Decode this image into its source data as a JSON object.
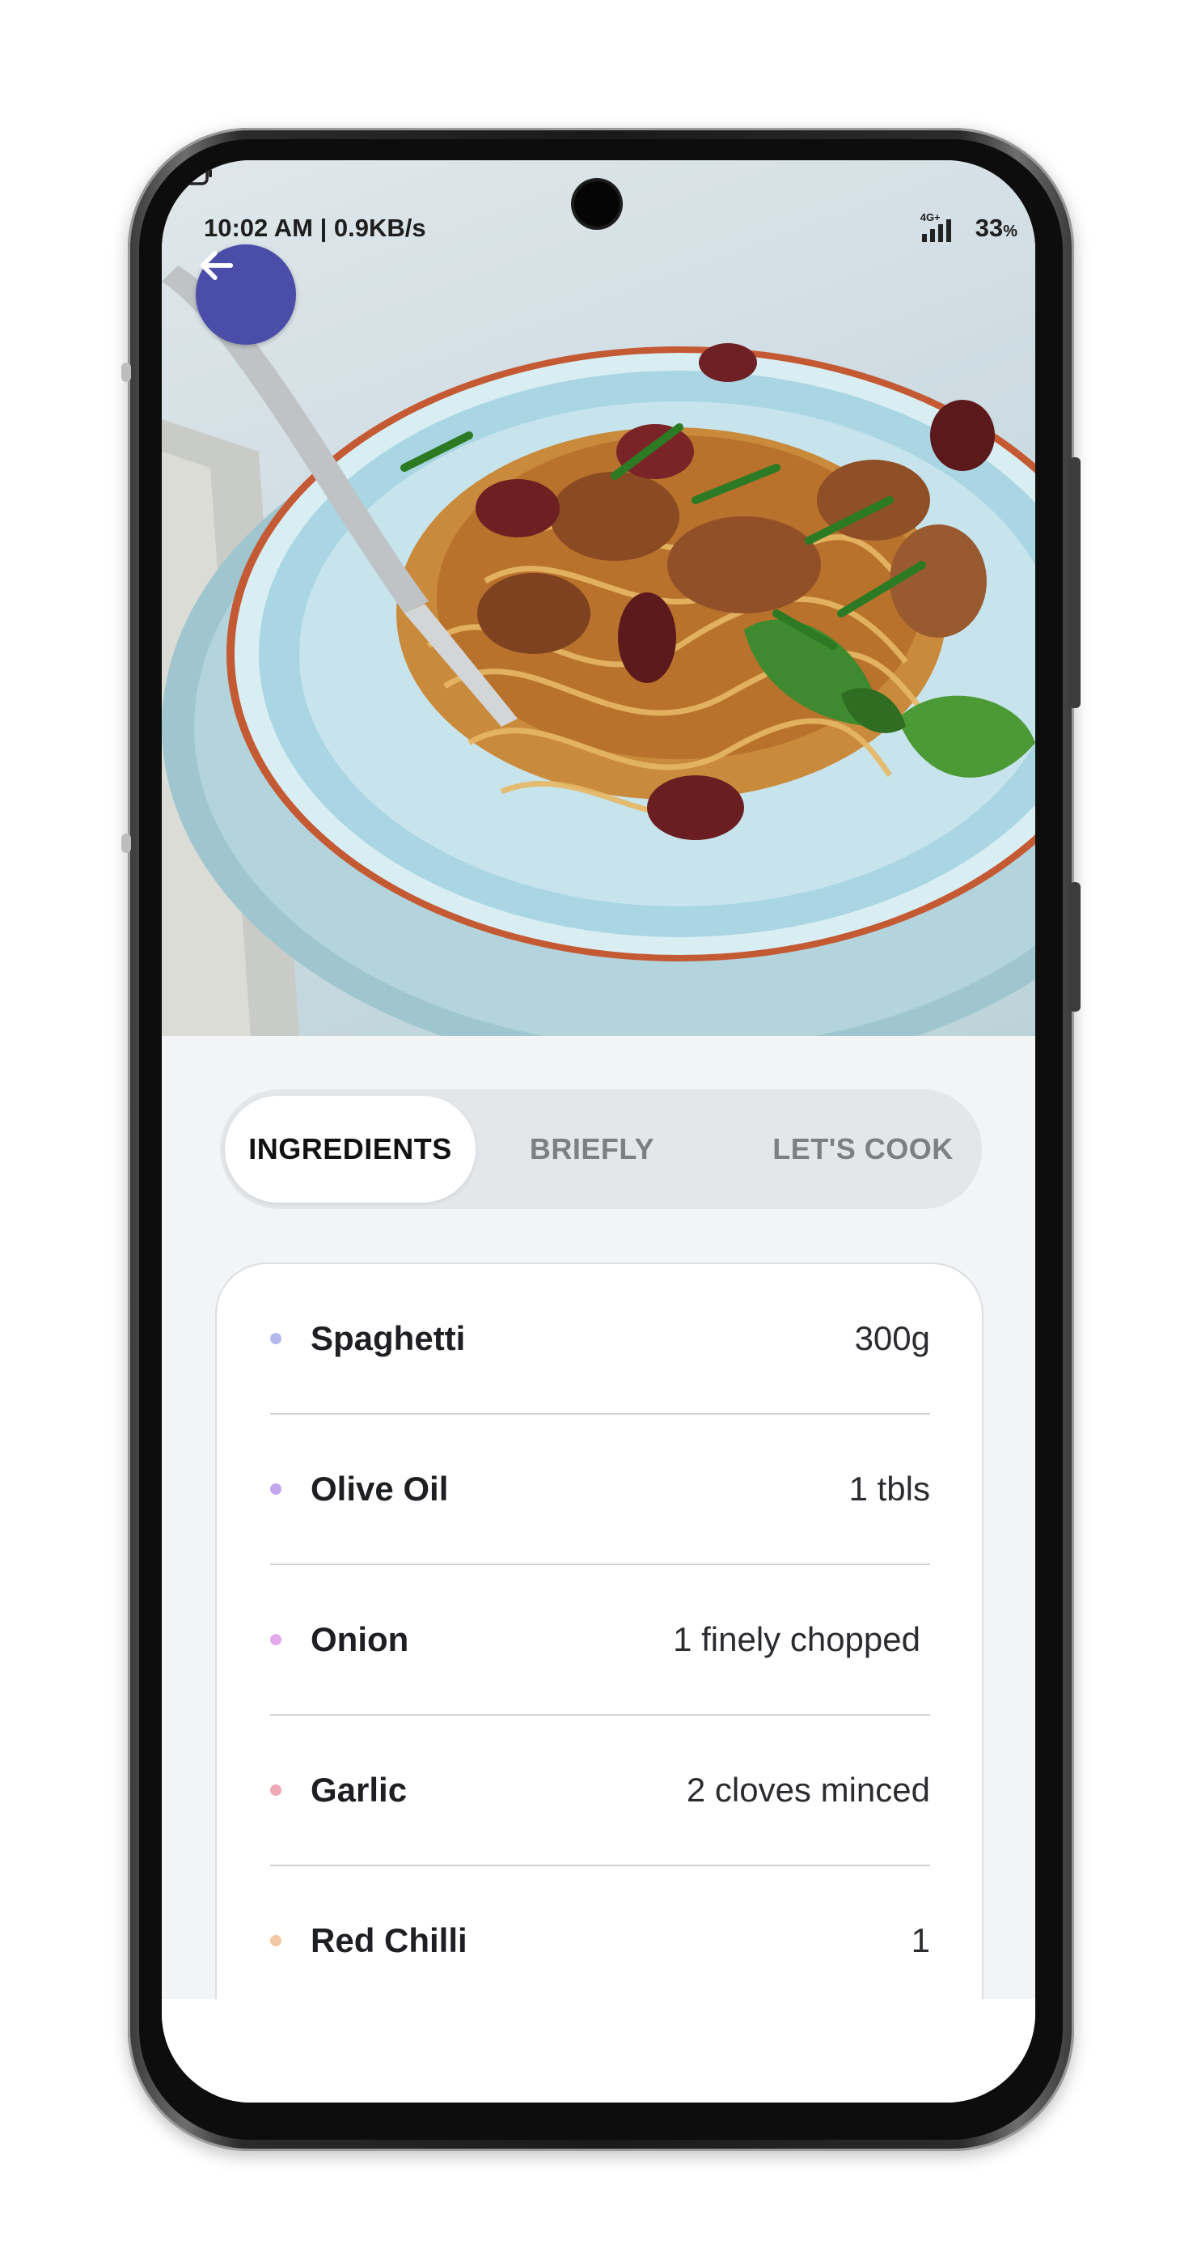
{
  "status_bar": {
    "time_speed": "10:02 AM | 0.9KB/s",
    "network_label": "4G+",
    "battery": "33"
  },
  "tabs": [
    {
      "label": "INGREDIENTS",
      "active": true
    },
    {
      "label": "BRIEFLY",
      "active": false
    },
    {
      "label": "LET'S COOK",
      "active": false
    }
  ],
  "ingredients": [
    {
      "name": "Spaghetti",
      "qty": "300g",
      "dot_color": "#b3b9ee"
    },
    {
      "name": "Olive Oil",
      "qty": "1 tbls",
      "dot_color": "#c2a6f0"
    },
    {
      "name": "Onion",
      "qty": "1 finely chopped",
      "dot_color": "#e4a8ec"
    },
    {
      "name": "Garlic",
      "qty": "2 cloves minced",
      "dot_color": "#f0a7b4"
    },
    {
      "name": "Red Chilli",
      "qty": "1",
      "dot_color": "#f3c8a4"
    }
  ],
  "colors": {
    "accent": "#4a4ea8",
    "background": "#f2f4f6",
    "tab_track": "#e3e7ea"
  },
  "icons": [
    "back-arrow-icon",
    "gear-icon",
    "wifi-icon",
    "signal-icon",
    "battery-icon"
  ]
}
